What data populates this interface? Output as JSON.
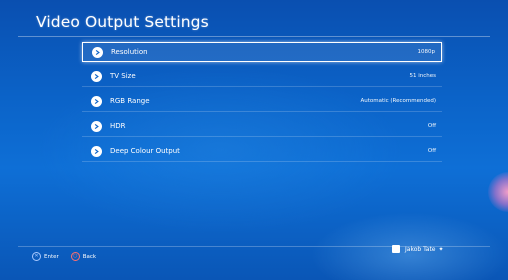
{
  "page": {
    "title": "Video Output Settings"
  },
  "menu": {
    "items": [
      {
        "label": "Resolution",
        "value": "1080p",
        "selected": true
      },
      {
        "label": "TV Size",
        "value": "51 inches"
      },
      {
        "label": "RGB Range",
        "value": "Automatic (Recommended)"
      },
      {
        "label": "HDR",
        "value": "Off"
      },
      {
        "label": "Deep Colour Output",
        "value": "Off"
      }
    ]
  },
  "footer": {
    "enter_label": "Enter",
    "back_label": "Back",
    "enter_glyph": "✕",
    "back_glyph": "○"
  },
  "user": {
    "name": "Jakob Tate",
    "suffix": "✦"
  },
  "colors": {
    "background_top": "#0a4fb0",
    "background_mid": "#0e6fd6",
    "text": "#ffffff"
  }
}
